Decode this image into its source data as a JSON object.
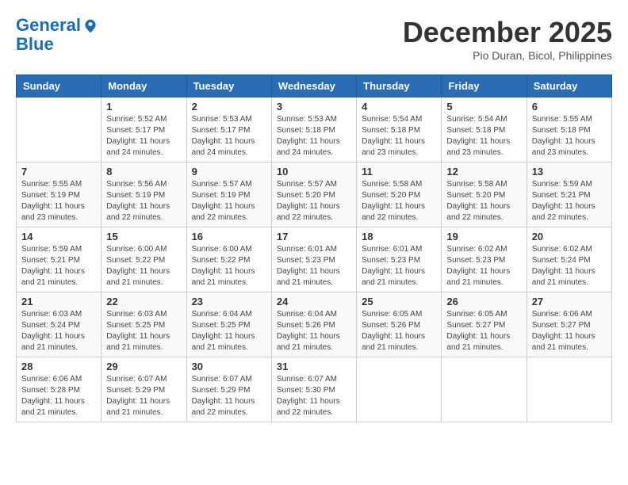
{
  "logo": {
    "line1": "General",
    "line2": "Blue"
  },
  "title": "December 2025",
  "location": "Pio Duran, Bicol, Philippines",
  "days_of_week": [
    "Sunday",
    "Monday",
    "Tuesday",
    "Wednesday",
    "Thursday",
    "Friday",
    "Saturday"
  ],
  "weeks": [
    [
      {
        "day": "",
        "sunrise": "",
        "sunset": "",
        "daylight": ""
      },
      {
        "day": "1",
        "sunrise": "Sunrise: 5:52 AM",
        "sunset": "Sunset: 5:17 PM",
        "daylight": "Daylight: 11 hours and 24 minutes."
      },
      {
        "day": "2",
        "sunrise": "Sunrise: 5:53 AM",
        "sunset": "Sunset: 5:17 PM",
        "daylight": "Daylight: 11 hours and 24 minutes."
      },
      {
        "day": "3",
        "sunrise": "Sunrise: 5:53 AM",
        "sunset": "Sunset: 5:18 PM",
        "daylight": "Daylight: 11 hours and 24 minutes."
      },
      {
        "day": "4",
        "sunrise": "Sunrise: 5:54 AM",
        "sunset": "Sunset: 5:18 PM",
        "daylight": "Daylight: 11 hours and 23 minutes."
      },
      {
        "day": "5",
        "sunrise": "Sunrise: 5:54 AM",
        "sunset": "Sunset: 5:18 PM",
        "daylight": "Daylight: 11 hours and 23 minutes."
      },
      {
        "day": "6",
        "sunrise": "Sunrise: 5:55 AM",
        "sunset": "Sunset: 5:18 PM",
        "daylight": "Daylight: 11 hours and 23 minutes."
      }
    ],
    [
      {
        "day": "7",
        "sunrise": "Sunrise: 5:55 AM",
        "sunset": "Sunset: 5:19 PM",
        "daylight": "Daylight: 11 hours and 23 minutes."
      },
      {
        "day": "8",
        "sunrise": "Sunrise: 5:56 AM",
        "sunset": "Sunset: 5:19 PM",
        "daylight": "Daylight: 11 hours and 22 minutes."
      },
      {
        "day": "9",
        "sunrise": "Sunrise: 5:57 AM",
        "sunset": "Sunset: 5:19 PM",
        "daylight": "Daylight: 11 hours and 22 minutes."
      },
      {
        "day": "10",
        "sunrise": "Sunrise: 5:57 AM",
        "sunset": "Sunset: 5:20 PM",
        "daylight": "Daylight: 11 hours and 22 minutes."
      },
      {
        "day": "11",
        "sunrise": "Sunrise: 5:58 AM",
        "sunset": "Sunset: 5:20 PM",
        "daylight": "Daylight: 11 hours and 22 minutes."
      },
      {
        "day": "12",
        "sunrise": "Sunrise: 5:58 AM",
        "sunset": "Sunset: 5:20 PM",
        "daylight": "Daylight: 11 hours and 22 minutes."
      },
      {
        "day": "13",
        "sunrise": "Sunrise: 5:59 AM",
        "sunset": "Sunset: 5:21 PM",
        "daylight": "Daylight: 11 hours and 22 minutes."
      }
    ],
    [
      {
        "day": "14",
        "sunrise": "Sunrise: 5:59 AM",
        "sunset": "Sunset: 5:21 PM",
        "daylight": "Daylight: 11 hours and 21 minutes."
      },
      {
        "day": "15",
        "sunrise": "Sunrise: 6:00 AM",
        "sunset": "Sunset: 5:22 PM",
        "daylight": "Daylight: 11 hours and 21 minutes."
      },
      {
        "day": "16",
        "sunrise": "Sunrise: 6:00 AM",
        "sunset": "Sunset: 5:22 PM",
        "daylight": "Daylight: 11 hours and 21 minutes."
      },
      {
        "day": "17",
        "sunrise": "Sunrise: 6:01 AM",
        "sunset": "Sunset: 5:23 PM",
        "daylight": "Daylight: 11 hours and 21 minutes."
      },
      {
        "day": "18",
        "sunrise": "Sunrise: 6:01 AM",
        "sunset": "Sunset: 5:23 PM",
        "daylight": "Daylight: 11 hours and 21 minutes."
      },
      {
        "day": "19",
        "sunrise": "Sunrise: 6:02 AM",
        "sunset": "Sunset: 5:23 PM",
        "daylight": "Daylight: 11 hours and 21 minutes."
      },
      {
        "day": "20",
        "sunrise": "Sunrise: 6:02 AM",
        "sunset": "Sunset: 5:24 PM",
        "daylight": "Daylight: 11 hours and 21 minutes."
      }
    ],
    [
      {
        "day": "21",
        "sunrise": "Sunrise: 6:03 AM",
        "sunset": "Sunset: 5:24 PM",
        "daylight": "Daylight: 11 hours and 21 minutes."
      },
      {
        "day": "22",
        "sunrise": "Sunrise: 6:03 AM",
        "sunset": "Sunset: 5:25 PM",
        "daylight": "Daylight: 11 hours and 21 minutes."
      },
      {
        "day": "23",
        "sunrise": "Sunrise: 6:04 AM",
        "sunset": "Sunset: 5:25 PM",
        "daylight": "Daylight: 11 hours and 21 minutes."
      },
      {
        "day": "24",
        "sunrise": "Sunrise: 6:04 AM",
        "sunset": "Sunset: 5:26 PM",
        "daylight": "Daylight: 11 hours and 21 minutes."
      },
      {
        "day": "25",
        "sunrise": "Sunrise: 6:05 AM",
        "sunset": "Sunset: 5:26 PM",
        "daylight": "Daylight: 11 hours and 21 minutes."
      },
      {
        "day": "26",
        "sunrise": "Sunrise: 6:05 AM",
        "sunset": "Sunset: 5:27 PM",
        "daylight": "Daylight: 11 hours and 21 minutes."
      },
      {
        "day": "27",
        "sunrise": "Sunrise: 6:06 AM",
        "sunset": "Sunset: 5:27 PM",
        "daylight": "Daylight: 11 hours and 21 minutes."
      }
    ],
    [
      {
        "day": "28",
        "sunrise": "Sunrise: 6:06 AM",
        "sunset": "Sunset: 5:28 PM",
        "daylight": "Daylight: 11 hours and 21 minutes."
      },
      {
        "day": "29",
        "sunrise": "Sunrise: 6:07 AM",
        "sunset": "Sunset: 5:29 PM",
        "daylight": "Daylight: 11 hours and 21 minutes."
      },
      {
        "day": "30",
        "sunrise": "Sunrise: 6:07 AM",
        "sunset": "Sunset: 5:29 PM",
        "daylight": "Daylight: 11 hours and 22 minutes."
      },
      {
        "day": "31",
        "sunrise": "Sunrise: 6:07 AM",
        "sunset": "Sunset: 5:30 PM",
        "daylight": "Daylight: 11 hours and 22 minutes."
      },
      {
        "day": "",
        "sunrise": "",
        "sunset": "",
        "daylight": ""
      },
      {
        "day": "",
        "sunrise": "",
        "sunset": "",
        "daylight": ""
      },
      {
        "day": "",
        "sunrise": "",
        "sunset": "",
        "daylight": ""
      }
    ]
  ]
}
